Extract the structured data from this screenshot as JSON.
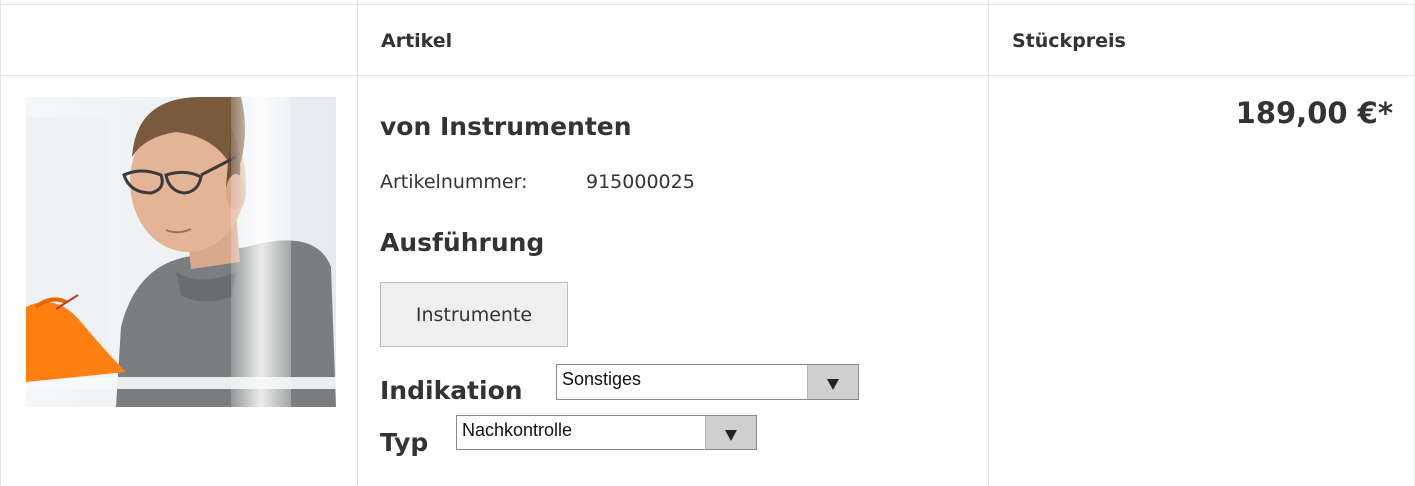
{
  "table_header": {
    "article": "Artikel",
    "unit_price": "Stückpreis"
  },
  "item": {
    "name": "von Instrumenten",
    "article_number_label": "Artikelnummer:",
    "article_number": "915000025",
    "variant_heading": "Ausführung",
    "variant_option": "Instrumente",
    "indication_label": "Indikation",
    "indication_value": "Sonstiges",
    "type_label": "Typ",
    "type_value": "Nachkontrolle",
    "price": "189,00 €*"
  },
  "colors": {
    "glove": "#ff7f11",
    "border": "#e6e6e6",
    "text": "#333333"
  }
}
